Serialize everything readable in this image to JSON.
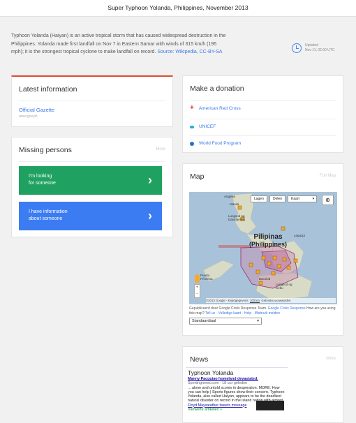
{
  "header": {
    "title": "Super Typhoon Yolanda, Philippines, November 2013"
  },
  "intro": {
    "text": "Typhoon Yolanda (Haiyan) is an active tropical storm that has caused widespread destruction in the Philippines. Yolanda made first landfall on Nov 7 in Eastern Samar with winds of 315 km/h (195 mph); it is the strongest tropical cyclone to make landfall on record.",
    "source_label": "Source: Wikipedia, CC-BY-SA"
  },
  "updated": {
    "label": "Updated",
    "time": "Nov 11, 02:00 UTC"
  },
  "latest": {
    "title": "Latest information",
    "link_label": "Official Gazette",
    "link_url": "www.gov.ph"
  },
  "missing": {
    "title": "Missing persons",
    "more": "More",
    "looking_line1": "I'm looking",
    "looking_line2": "for someone",
    "info_line1": "I have information",
    "info_line2": "about someone",
    "chevron": "›"
  },
  "donation": {
    "title": "Make a donation",
    "items": [
      "American Red Cross",
      "UNICEF",
      "World Food Program"
    ]
  },
  "map": {
    "title": "Map",
    "full_map": "Full Map",
    "btn_layers": "Lagen",
    "btn_share": "Delen",
    "btn_map": "Kaart",
    "country_label_1": "Pilipinas",
    "country_label_2": "(Philippines)",
    "places": [
      "Angeles",
      "Manila",
      "Lungsod ng Dasmariñas",
      "Puerto Princesa",
      "Lungsod ng Cebu",
      "Bacolod",
      "Legazpi"
    ],
    "copyright": "©2013 Google - Kaartgegevens",
    "scale": "100 km",
    "terms": "Gebruiksvoorwaarden",
    "footer_text": "Gepubliceerd door Google Crisis Response Team.",
    "footer_link": "Google Crisis Response",
    "footer_q": "How are you using this map?",
    "footer_links": "Tell us · Volledige kaart · Help · Misbruik melden",
    "select_value": "Standaardtaal"
  },
  "news": {
    "title": "News",
    "more": "More",
    "widget_title": "Typhoon Yolanda",
    "headline1": "Manny Pacquiao homeland devastated:",
    "source1": "Sportingnews.com - 18 uur geleden",
    "snippet1": "... alone and untold scores in desperation. MORE: How you can help | Sports figures show their concern. Typhoon Yolanda, also called Haiyan, appears to be the deadliest natural disaster on record in the island nation with almost four in 10 U.S. and ...",
    "headline2": "Floyd Mayweather tweets message",
    "source2": "Vierwerte artikelen »"
  }
}
